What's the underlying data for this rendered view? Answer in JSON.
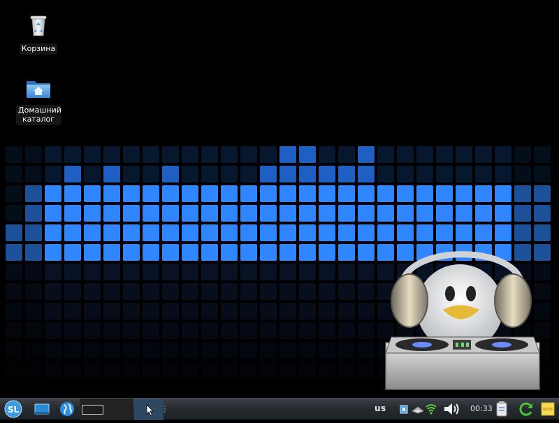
{
  "desktop": {
    "icons": [
      {
        "name": "trash",
        "label": "Корзина",
        "icon": "trash-icon"
      },
      {
        "name": "home-folder",
        "label": "Домашний каталог",
        "icon": "home-folder-icon"
      }
    ],
    "wallpaper": {
      "theme": "equalizer-grid",
      "colors": {
        "bright": "#2f86ff",
        "mid": "#1f5fc4",
        "dark": "#0c2a52",
        "dim": "#0b1830"
      }
    }
  },
  "taskbar": {
    "start_icon": "start-menu-logo-icon",
    "start_text": "SL",
    "launchers": [
      {
        "name": "show-desktop",
        "icon": "show-desktop-icon"
      },
      {
        "name": "browser",
        "icon": "globe-icon"
      }
    ],
    "keyboard_layout": "us",
    "tray_icons": [
      "network-icon",
      "ethernet-icon",
      "wifi-icon",
      "volume-icon"
    ],
    "clock": "00:33",
    "right_icons": [
      "clipboard-icon",
      "update-arrow-icon",
      "notes-icon"
    ],
    "notes_text": "NOTE"
  }
}
